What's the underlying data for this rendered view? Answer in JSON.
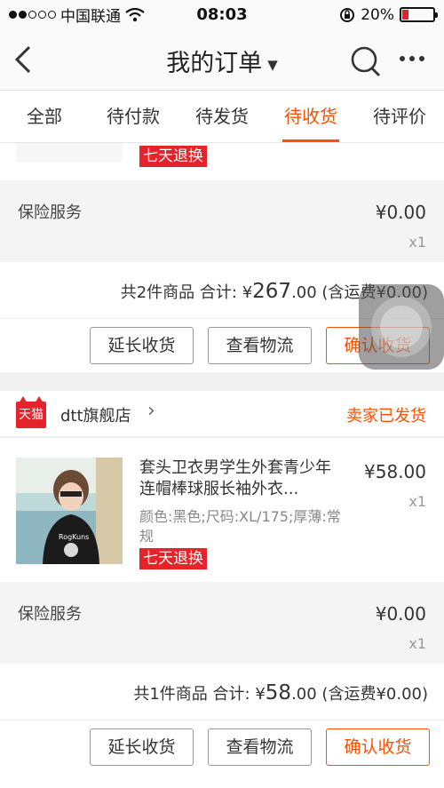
{
  "status_bar": {
    "carrier": "中国联通",
    "time": "08:03",
    "battery": "20%",
    "battery_level": 0.2
  },
  "nav": {
    "title": "我的订单"
  },
  "tabs": [
    {
      "label": "全部"
    },
    {
      "label": "待付款"
    },
    {
      "label": "待发货"
    },
    {
      "label": "待收货",
      "active": true
    },
    {
      "label": "待评价"
    }
  ],
  "order1": {
    "tag": "七天退换",
    "insurance_label": "保险服务",
    "insurance_price": "¥0.00",
    "insurance_qty": "x1",
    "summary_prefix": "共2件商品 合计: ¥",
    "summary_total": "267",
    "summary_decimal": ".00",
    "summary_shipping": " (含运费¥0.00)",
    "buttons": {
      "extend": "延长收货",
      "logistics": "查看物流",
      "confirm": "确认收货"
    }
  },
  "order2": {
    "shop_logo": "天猫",
    "shop_name": "dtt旗舰店",
    "shop_status": "卖家已发货",
    "product_title": "套头卫衣男学生外套青少年连帽棒球服长袖外衣...",
    "product_spec": "颜色:黑色;尺码:XL/175;厚薄:常规",
    "product_price": "¥58.00",
    "product_qty": "x1",
    "tag": "七天退换",
    "insurance_label": "保险服务",
    "insurance_price": "¥0.00",
    "insurance_qty": "x1",
    "summary_prefix": "共1件商品 合计: ¥",
    "summary_total": "58",
    "summary_decimal": ".00",
    "summary_shipping": " (含运费¥0.00)",
    "buttons": {
      "extend": "延长收货",
      "logistics": "查看物流",
      "confirm": "确认收货"
    }
  },
  "colors": {
    "accent": "#ff5000",
    "tag_red": "#e4232a"
  }
}
